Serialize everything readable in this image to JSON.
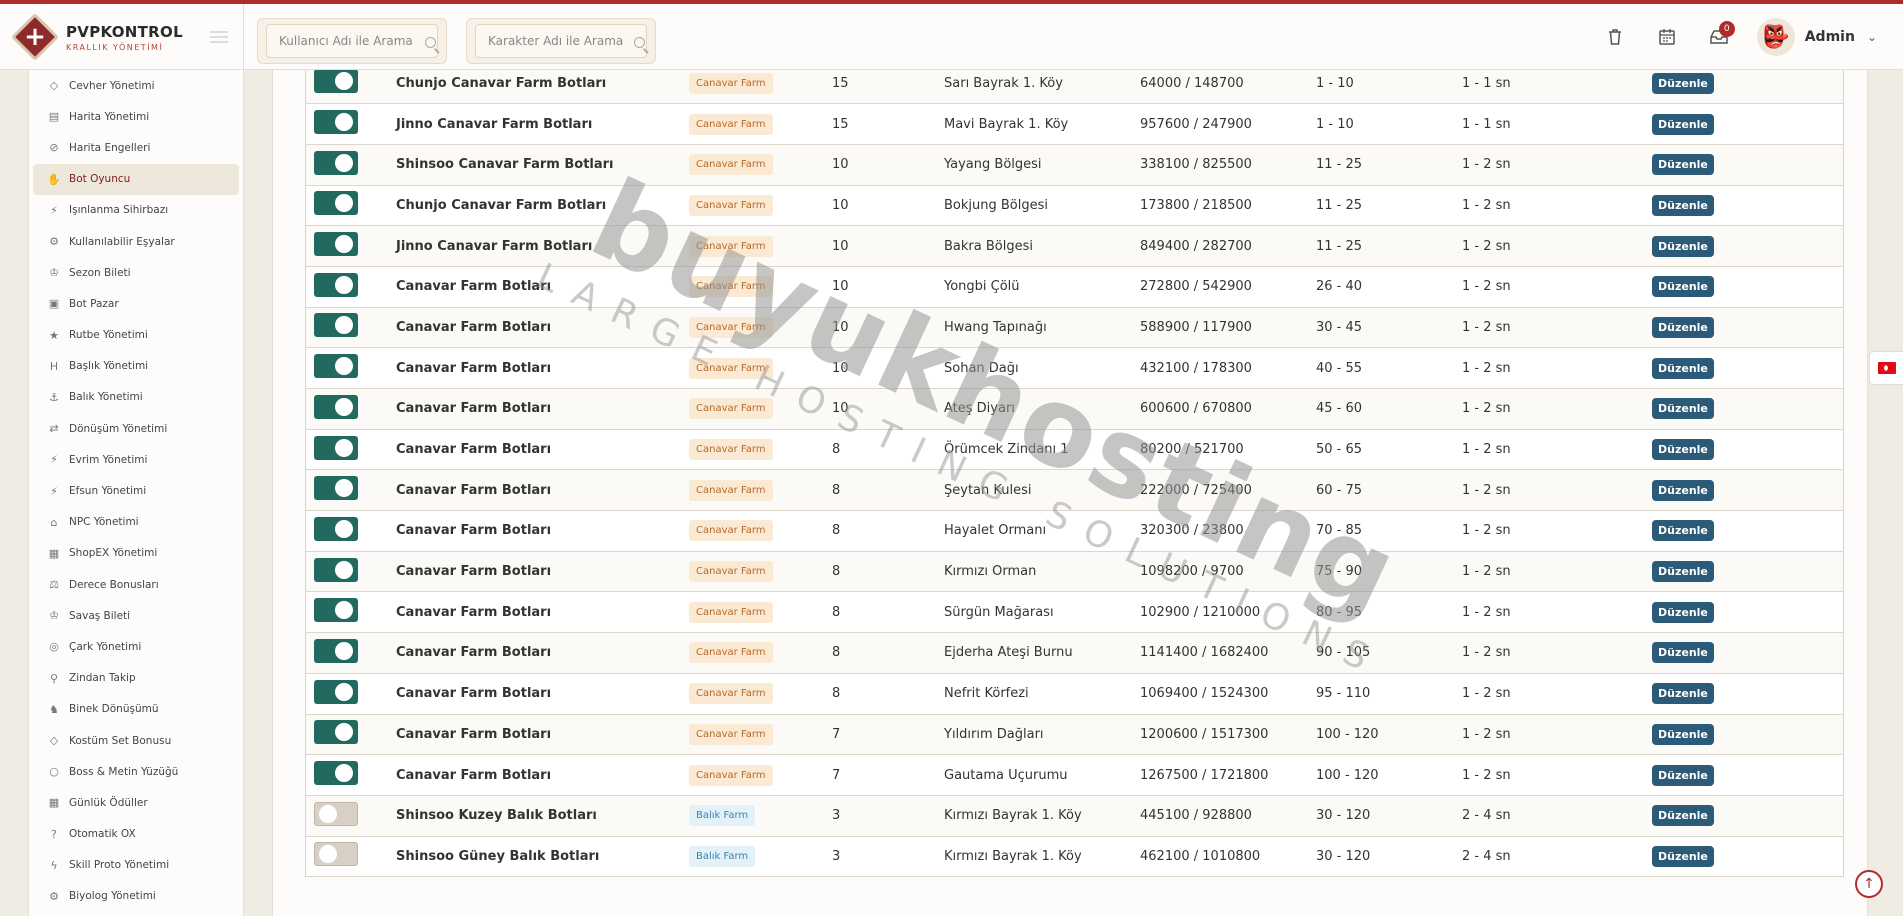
{
  "brand": {
    "title": "PVPKONTROL",
    "subtitle": "KRALLIK YÖNETİMİ"
  },
  "search": {
    "user_placeholder": "Kullanıcı Adı ile Arama",
    "char_placeholder": "Karakter Adı ile Arama"
  },
  "header": {
    "notification_count": "0",
    "user_name": "Admin"
  },
  "sidebar": {
    "items": [
      {
        "label": "Cevher Yönetimi",
        "icon": "gem-icon",
        "glyph": "◇"
      },
      {
        "label": "Harita Yönetimi",
        "icon": "map-icon",
        "glyph": "▤"
      },
      {
        "label": "Harita Engelleri",
        "icon": "ban-icon",
        "glyph": "⊘"
      },
      {
        "label": "Bot Oyuncu",
        "icon": "hand-icon",
        "glyph": "✋",
        "active": true
      },
      {
        "label": "Işınlanma Sihirbazı",
        "icon": "wand-icon",
        "glyph": "⚡"
      },
      {
        "label": "Kullanılabilir Eşyalar",
        "icon": "gears-icon",
        "glyph": "⚙"
      },
      {
        "label": "Sezon Bileti",
        "icon": "trophy-icon",
        "glyph": "♔"
      },
      {
        "label": "Bot Pazar",
        "icon": "cart-icon",
        "glyph": "▣"
      },
      {
        "label": "Rutbe Yönetimi",
        "icon": "star-icon",
        "glyph": "★"
      },
      {
        "label": "Başlık Yönetimi",
        "icon": "heading-icon",
        "glyph": "H"
      },
      {
        "label": "Balık Yönetimi",
        "icon": "anchor-icon",
        "glyph": "⚓"
      },
      {
        "label": "Dönüşüm Yönetimi",
        "icon": "shuffle-icon",
        "glyph": "⇄"
      },
      {
        "label": "Evrim Yönetimi",
        "icon": "wand-icon",
        "glyph": "⚡"
      },
      {
        "label": "Efsun Yönetimi",
        "icon": "wand-icon",
        "glyph": "⚡"
      },
      {
        "label": "NPC Yönetimi",
        "icon": "building-icon",
        "glyph": "⌂"
      },
      {
        "label": "ShopEX Yönetimi",
        "icon": "store-icon",
        "glyph": "▦"
      },
      {
        "label": "Derece Bonusları",
        "icon": "balance-icon",
        "glyph": "⚖"
      },
      {
        "label": "Savaş Bileti",
        "icon": "trophy-icon",
        "glyph": "♔"
      },
      {
        "label": "Çark Yönetimi",
        "icon": "globe-icon",
        "glyph": "◎"
      },
      {
        "label": "Zindan Takip",
        "icon": "pin-icon",
        "glyph": "⚲"
      },
      {
        "label": "Binek Dönüşümü",
        "icon": "horse-icon",
        "glyph": "♞"
      },
      {
        "label": "Kostüm Set Bonusu",
        "icon": "gem-icon",
        "glyph": "◇"
      },
      {
        "label": "Boss & Metin Yüzüğü",
        "icon": "ring-icon",
        "glyph": "○"
      },
      {
        "label": "Günlük Ödüller",
        "icon": "calendar-icon",
        "glyph": "▦"
      },
      {
        "label": "Otomatik OX",
        "icon": "question-icon",
        "glyph": "?"
      },
      {
        "label": "Skill Proto Yönetimi",
        "icon": "bolt-icon",
        "glyph": "ϟ"
      },
      {
        "label": "Biyolog Yönetimi",
        "icon": "gears-icon",
        "glyph": "⚙"
      }
    ]
  },
  "table": {
    "edit_label": "Düzenle",
    "rows": [
      {
        "on": true,
        "name": "Chunjo Canavar Farm Botları",
        "type": "Canavar Farm",
        "kind": "monster",
        "level": "15",
        "map": "Sarı Bayrak 1. Köy",
        "coord": "64000 / 148700",
        "range": "1 - 10",
        "delay": "1 - 1 sn"
      },
      {
        "on": true,
        "name": "Jinno Canavar Farm Botları",
        "type": "Canavar Farm",
        "kind": "monster",
        "level": "15",
        "map": "Mavi Bayrak 1. Köy",
        "coord": "957600 / 247900",
        "range": "1 - 10",
        "delay": "1 - 1 sn"
      },
      {
        "on": true,
        "name": "Shinsoo Canavar Farm Botları",
        "type": "Canavar Farm",
        "kind": "monster",
        "level": "10",
        "map": "Yayang Bölgesi",
        "coord": "338100 / 825500",
        "range": "11 - 25",
        "delay": "1 - 2 sn"
      },
      {
        "on": true,
        "name": "Chunjo Canavar Farm Botları",
        "type": "Canavar Farm",
        "kind": "monster",
        "level": "10",
        "map": "Bokjung Bölgesi",
        "coord": "173800 / 218500",
        "range": "11 - 25",
        "delay": "1 - 2 sn"
      },
      {
        "on": true,
        "name": "Jinno Canavar Farm Botları",
        "type": "Canavar Farm",
        "kind": "monster",
        "level": "10",
        "map": "Bakra Bölgesi",
        "coord": "849400 / 282700",
        "range": "11 - 25",
        "delay": "1 - 2 sn"
      },
      {
        "on": true,
        "name": "Canavar Farm Botları",
        "type": "Canavar Farm",
        "kind": "monster",
        "level": "10",
        "map": "Yongbi Çölü",
        "coord": "272800 / 542900",
        "range": "26 - 40",
        "delay": "1 - 2 sn"
      },
      {
        "on": true,
        "name": "Canavar Farm Botları",
        "type": "Canavar Farm",
        "kind": "monster",
        "level": "10",
        "map": "Hwang Tapınağı",
        "coord": "588900 / 117900",
        "range": "30 - 45",
        "delay": "1 - 2 sn"
      },
      {
        "on": true,
        "name": "Canavar Farm Botları",
        "type": "Canavar Farm",
        "kind": "monster",
        "level": "10",
        "map": "Sohan Dağı",
        "coord": "432100 / 178300",
        "range": "40 - 55",
        "delay": "1 - 2 sn"
      },
      {
        "on": true,
        "name": "Canavar Farm Botları",
        "type": "Canavar Farm",
        "kind": "monster",
        "level": "10",
        "map": "Ateş Diyarı",
        "coord": "600600 / 670800",
        "range": "45 - 60",
        "delay": "1 - 2 sn"
      },
      {
        "on": true,
        "name": "Canavar Farm Botları",
        "type": "Canavar Farm",
        "kind": "monster",
        "level": "8",
        "map": "Örümcek Zindanı 1",
        "coord": "80200 / 521700",
        "range": "50 - 65",
        "delay": "1 - 2 sn"
      },
      {
        "on": true,
        "name": "Canavar Farm Botları",
        "type": "Canavar Farm",
        "kind": "monster",
        "level": "8",
        "map": "Şeytan Kulesi",
        "coord": "222000 / 725400",
        "range": "60 - 75",
        "delay": "1 - 2 sn"
      },
      {
        "on": true,
        "name": "Canavar Farm Botları",
        "type": "Canavar Farm",
        "kind": "monster",
        "level": "8",
        "map": "Hayalet Ormanı",
        "coord": "320300 / 23800",
        "range": "70 - 85",
        "delay": "1 - 2 sn"
      },
      {
        "on": true,
        "name": "Canavar Farm Botları",
        "type": "Canavar Farm",
        "kind": "monster",
        "level": "8",
        "map": "Kırmızı Orman",
        "coord": "1098200 / 9700",
        "range": "75 - 90",
        "delay": "1 - 2 sn"
      },
      {
        "on": true,
        "name": "Canavar Farm Botları",
        "type": "Canavar Farm",
        "kind": "monster",
        "level": "8",
        "map": "Sürgün Mağarası",
        "coord": "102900 / 1210000",
        "range": "80 - 95",
        "delay": "1 - 2 sn"
      },
      {
        "on": true,
        "name": "Canavar Farm Botları",
        "type": "Canavar Farm",
        "kind": "monster",
        "level": "8",
        "map": "Ejderha Ateşi Burnu",
        "coord": "1141400 / 1682400",
        "range": "90 - 105",
        "delay": "1 - 2 sn"
      },
      {
        "on": true,
        "name": "Canavar Farm Botları",
        "type": "Canavar Farm",
        "kind": "monster",
        "level": "8",
        "map": "Nefrit Körfezi",
        "coord": "1069400 / 1524300",
        "range": "95 - 110",
        "delay": "1 - 2 sn"
      },
      {
        "on": true,
        "name": "Canavar Farm Botları",
        "type": "Canavar Farm",
        "kind": "monster",
        "level": "7",
        "map": "Yıldırım Dağları",
        "coord": "1200600 / 1517300",
        "range": "100 - 120",
        "delay": "1 - 2 sn"
      },
      {
        "on": true,
        "name": "Canavar Farm Botları",
        "type": "Canavar Farm",
        "kind": "monster",
        "level": "7",
        "map": "Gautama Uçurumu",
        "coord": "1267500 / 1721800",
        "range": "100 - 120",
        "delay": "1 - 2 sn"
      },
      {
        "on": false,
        "name": "Shinsoo Kuzey Balık Botları",
        "type": "Balık Farm",
        "kind": "fish",
        "level": "3",
        "map": "Kırmızı Bayrak 1. Köy",
        "coord": "445100 / 928800",
        "range": "30 - 120",
        "delay": "2 - 4 sn"
      },
      {
        "on": false,
        "name": "Shinsoo Güney Balık Botları",
        "type": "Balık Farm",
        "kind": "fish",
        "level": "3",
        "map": "Kırmızı Bayrak 1. Köy",
        "coord": "462100 / 1010800",
        "range": "30 - 120",
        "delay": "2 - 4 sn"
      }
    ]
  },
  "watermark": {
    "title": "buyukhosting",
    "subtitle": "LARGE HOSTING SOLUTIONS"
  }
}
